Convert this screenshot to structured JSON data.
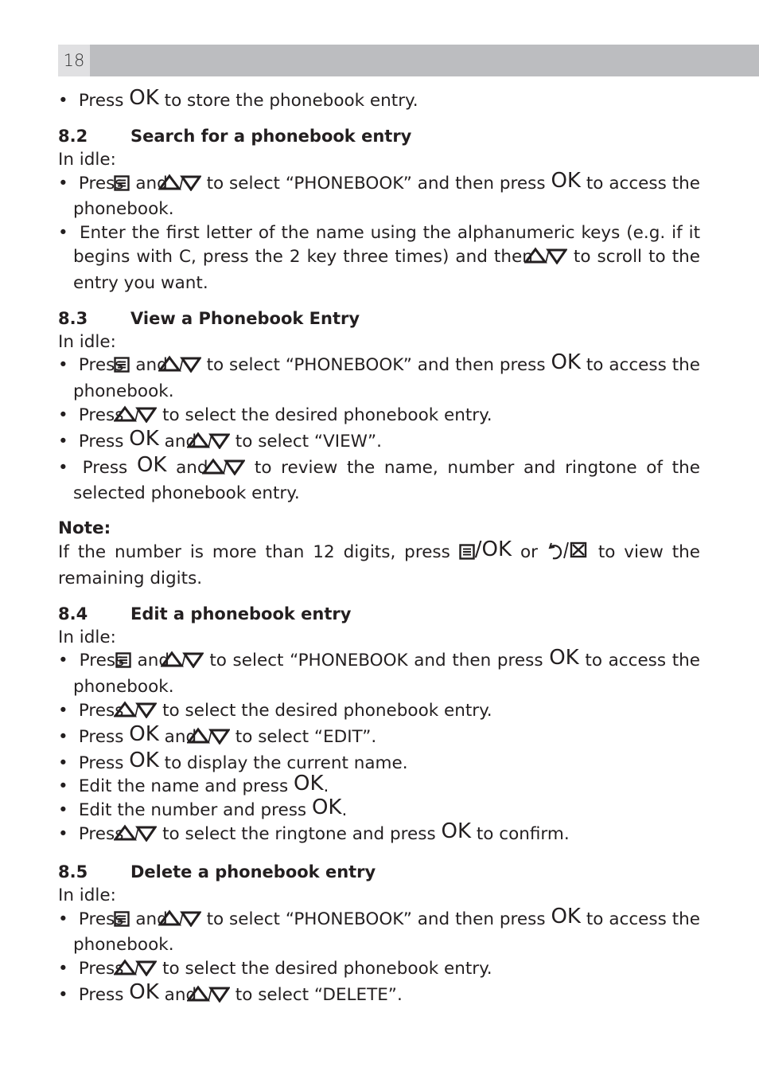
{
  "page_number": "18",
  "icons": {
    "ok": "OK",
    "menu": "menu-icon",
    "up": "up-arrow-icon",
    "down": "down-arrow-icon",
    "back": "back-icon",
    "delete": "delete-icon"
  },
  "intro": {
    "pre": "Press",
    "post": "to store the phonebook entry."
  },
  "s82": {
    "num": "8.2",
    "title": "Search for a phonebook entry",
    "idle": "In idle:",
    "b1": {
      "a": "Press",
      "b": "and",
      "c": "to select “PHONEBOOK” and then press",
      "d": "to access the phonebook."
    },
    "b2": {
      "a": "Enter the first letter of the name using the alphanumeric keys (e.g. if it begins with C, press the 2 key three times) and then",
      "b": "to scroll to the entry you want."
    }
  },
  "s83": {
    "num": "8.3",
    "title": "View a Phonebook Entry",
    "idle": "In idle:",
    "b1": {
      "a": "Press",
      "b": "and",
      "c": "to select “PHONEBOOK” and then press",
      "d": "to access the phonebook."
    },
    "b2": {
      "a": "Press",
      "b": "to select the desired phonebook entry."
    },
    "b3": {
      "a": "Press",
      "b": "and",
      "c": "to select “VIEW”."
    },
    "b4": {
      "a": "Press",
      "b": "and",
      "c": "to review the name, number and ringtone of the selected phonebook entry."
    }
  },
  "note": {
    "label": "Note:",
    "a": "If the number is more than 12 digits, press",
    "b": "/OK",
    "c": "or",
    "d": "to view the remaining digits."
  },
  "s84": {
    "num": "8.4",
    "title": "Edit a phonebook entry",
    "idle": "In idle:",
    "b1": {
      "a": "Press",
      "b": "and",
      "c": "to select “PHONEBOOK and then press",
      "d": "to access the phonebook."
    },
    "b2": {
      "a": "Press",
      "b": "to select the desired phonebook entry."
    },
    "b3": {
      "a": "Press",
      "b": "and",
      "c": "to select “EDIT”."
    },
    "b4": {
      "a": "Press",
      "b": "to display the current name."
    },
    "b5": {
      "a": "Edit the name and press",
      "b": "."
    },
    "b6": {
      "a": "Edit the number and press",
      "b": "."
    },
    "b7": {
      "a": "Press",
      "b": "to select the ringtone and press",
      "c": "to confirm."
    }
  },
  "s85": {
    "num": "8.5",
    "title": "Delete a phonebook entry",
    "idle": "In idle:",
    "b1": {
      "a": "Press",
      "b": "and",
      "c": "to select “PHONEBOOK” and then press",
      "d": "to access the phonebook."
    },
    "b2": {
      "a": "Press",
      "b": "to select the desired phonebook entry."
    },
    "b3": {
      "a": "Press",
      "b": "and",
      "c": "to select “DELETE”."
    }
  }
}
